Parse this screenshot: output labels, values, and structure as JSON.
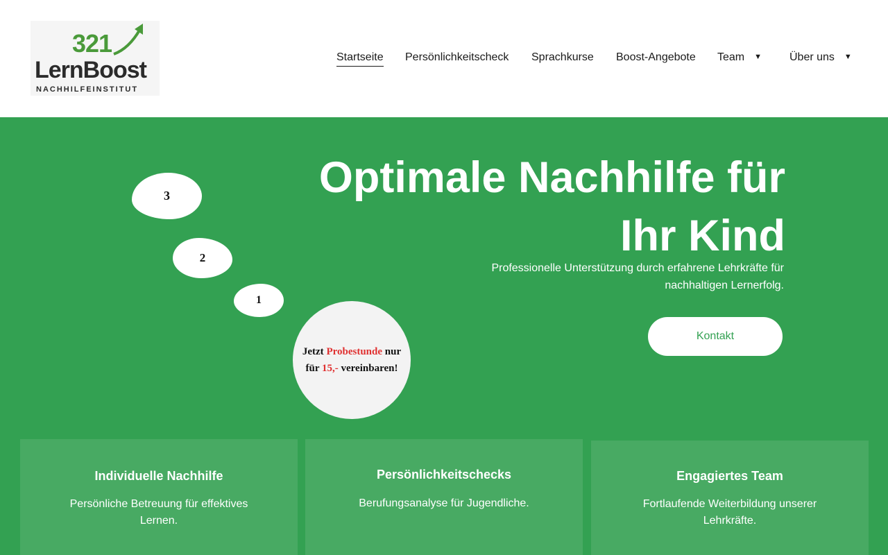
{
  "logo": {
    "number": "321",
    "name": "LernBoost",
    "tagline": "NACHHILFEINSTITUT"
  },
  "nav": {
    "items": [
      {
        "label": "Startseite",
        "active": true
      },
      {
        "label": "Persönlichkeitscheck"
      },
      {
        "label": "Sprachkurse"
      },
      {
        "label": "Boost-Angebote"
      },
      {
        "label": "Team",
        "dropdown": true
      },
      {
        "label": "Über uns",
        "dropdown": true
      }
    ],
    "caret": "▼"
  },
  "hero": {
    "title_line1": "Optimale Nachhilfe für",
    "title_line2": "Ihr Kind",
    "subtitle_line1": "Professionelle Unterstützung durch erfahrene Lehrkräfte für",
    "subtitle_line2": "nachhaltigen Lernerfolg.",
    "button": "Kontakt"
  },
  "steps": {
    "three": "3",
    "two": "2",
    "one": "1"
  },
  "trial": {
    "part1": "Jetzt ",
    "highlight1": "Probestunde",
    "part2": " nur",
    "part3": "für ",
    "highlight2": "15,-",
    "part4": " vereinbaren!"
  },
  "cards": [
    {
      "title": "Individuelle Nachhilfe",
      "text_line1": "Persönliche Betreuung für effektives",
      "text_line2": "Lernen."
    },
    {
      "title": "Persönlichkeitschecks",
      "text_line1": "Berufungsanalyse für Jugendliche.",
      "text_line2": ""
    },
    {
      "title": "Engagiertes Team",
      "text_line1": "Fortlaufende Weiterbildung unserer",
      "text_line2": "Lehrkräfte."
    }
  ],
  "colors": {
    "brand_green": "#33a152",
    "card_green": "#48aa63",
    "accent_red": "#e03131",
    "logo_green": "#4a9a3a"
  }
}
